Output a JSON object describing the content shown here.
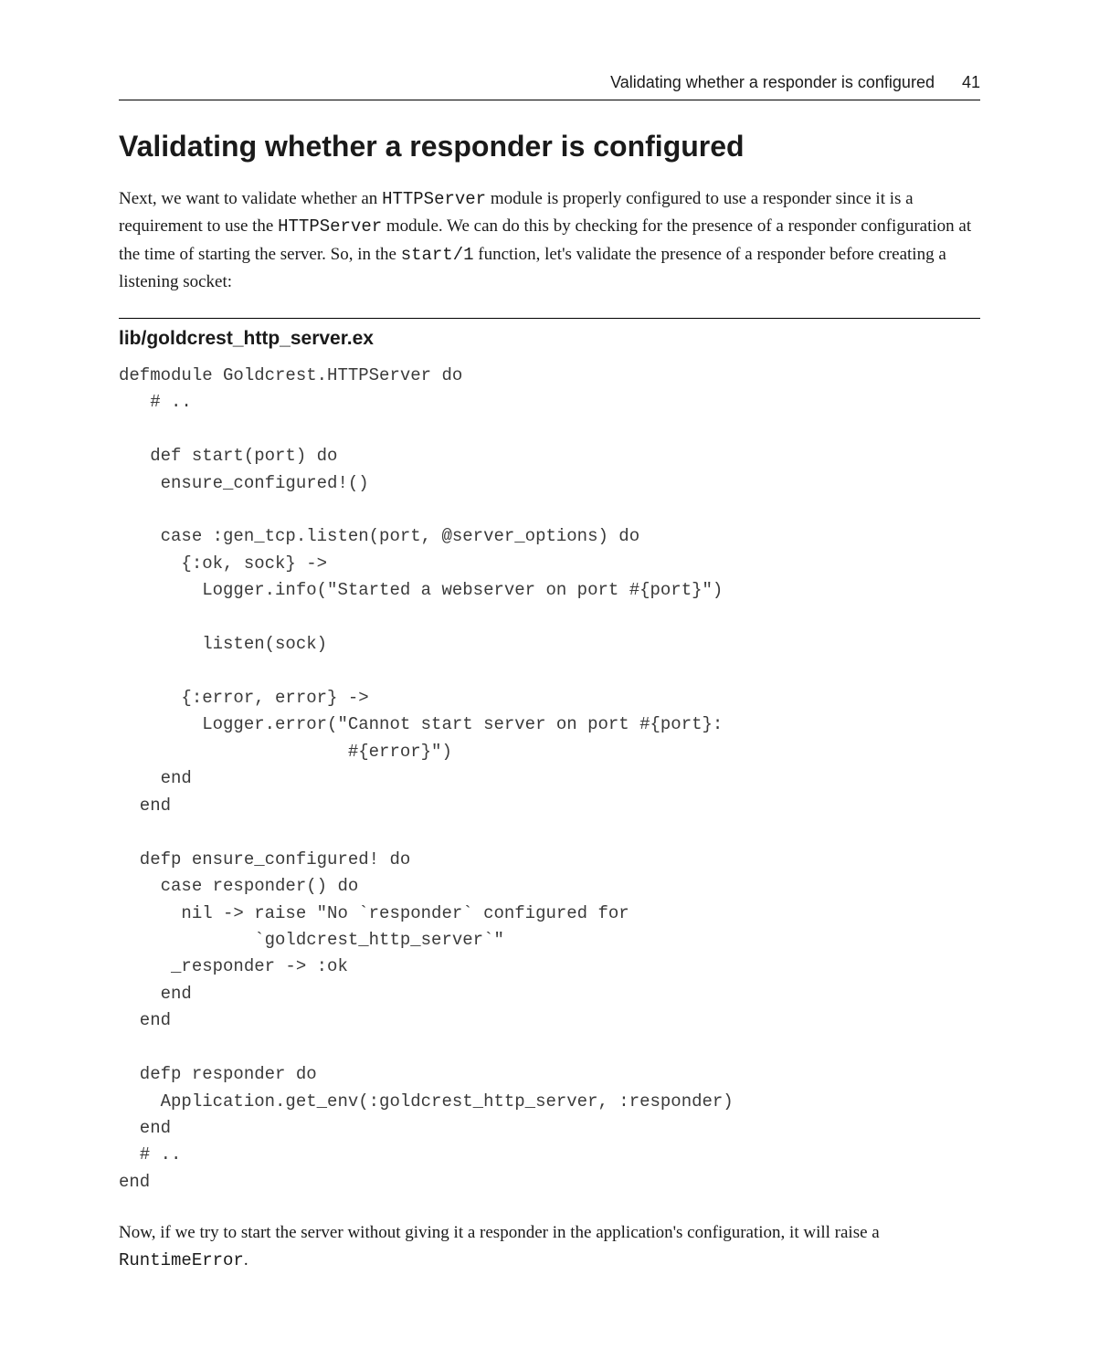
{
  "header": {
    "running_title": "Validating whether a responder is configured",
    "page_number": "41"
  },
  "section_heading": "Validating whether a responder is configured",
  "paragraph1_parts": {
    "p1": "Next, we want to validate whether an ",
    "c1": "HTTPServer",
    "p2": " module is properly configured to use a responder since it is a requirement to use the ",
    "c2": "HTTPServer",
    "p3": " module. We can do this by checking for the presence of a responder configuration at the time of starting the server. So, in the ",
    "c3": "start/1",
    "p4": " function, let's validate the presence of a responder before creating a listening socket:"
  },
  "file_label": "lib/goldcrest_http_server.ex",
  "code": "defmodule Goldcrest.HTTPServer do\n   # ..\n\n   def start(port) do\n    ensure_configured!()\n\n    case :gen_tcp.listen(port, @server_options) do\n      {:ok, sock} ->\n        Logger.info(\"Started a webserver on port #{port}\")\n\n        listen(sock)\n\n      {:error, error} ->\n        Logger.error(\"Cannot start server on port #{port}:\n                      #{error}\")\n    end\n  end\n\n  defp ensure_configured! do\n    case responder() do\n      nil -> raise \"No `responder` configured for\n             `goldcrest_http_server`\"\n     _responder -> :ok\n    end\n  end\n\n  defp responder do\n    Application.get_env(:goldcrest_http_server, :responder)\n  end\n  # ..\nend",
  "paragraph2_parts": {
    "p1": "Now, if we try to start the server without giving it a responder in the application's configuration, it will raise a ",
    "c1": "RuntimeError",
    "p2": "."
  }
}
